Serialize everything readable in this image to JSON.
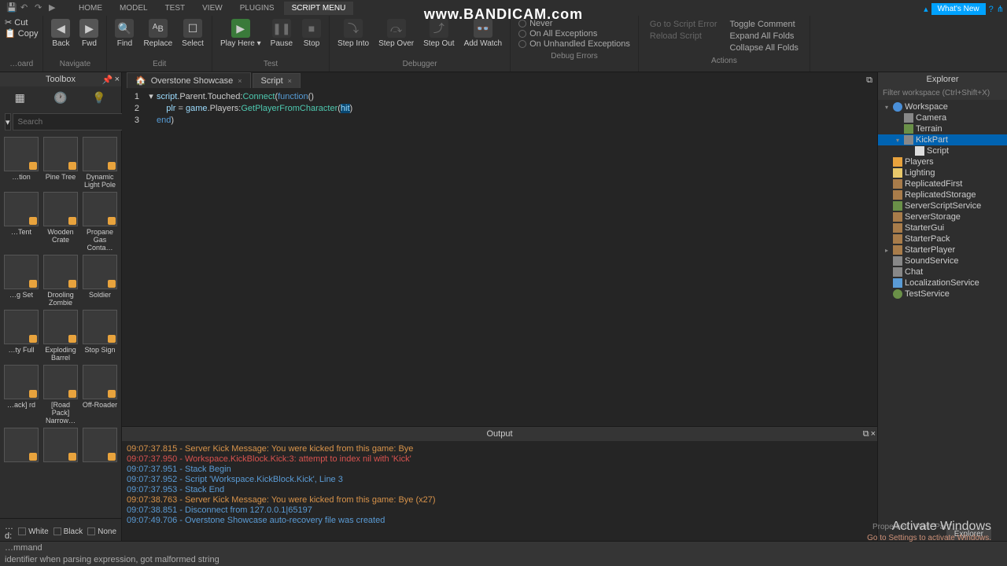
{
  "watermark": "www.BANDICAM.com",
  "menubar": {
    "tabs": [
      "HOME",
      "MODEL",
      "TEST",
      "VIEW",
      "PLUGINS",
      "SCRIPT MENU"
    ],
    "active": 5
  },
  "topright": {
    "whatsnew": "What's New"
  },
  "ribbon": {
    "clipboard": {
      "cut": "Cut",
      "copy": "Copy",
      "label": "…oard"
    },
    "navigate": {
      "back": "Back",
      "fwd": "Fwd",
      "label": "Navigate"
    },
    "edit": {
      "find": "Find",
      "replace": "Replace",
      "select": "Select",
      "label": "Edit"
    },
    "test": {
      "play": "Play\nHere ▾",
      "pause": "Pause",
      "stop": "Stop",
      "label": "Test"
    },
    "debugger": {
      "into": "Step\nInto",
      "over": "Step\nOver",
      "out": "Step\nOut",
      "add": "Add\nWatch",
      "label": "Debugger"
    },
    "errors": {
      "never": "Never",
      "all": "On All Exceptions",
      "unhandled": "On Unhandled Exceptions",
      "label": "Debug Errors"
    },
    "actions": {
      "goto": "Go to Script Error",
      "toggle": "Toggle Comment",
      "reload": "Reload Script",
      "expand": "Expand All Folds",
      "collapse": "Collapse All Folds",
      "label": "Actions"
    }
  },
  "toolbox": {
    "title": "Toolbox",
    "search_placeholder": "Search",
    "items": [
      {
        "label": "…tion"
      },
      {
        "label": "Pine Tree"
      },
      {
        "label": "Dynamic Light Pole"
      },
      {
        "label": "…Tent"
      },
      {
        "label": "Wooden Crate"
      },
      {
        "label": "Propane Gas Conta…"
      },
      {
        "label": "…g Set"
      },
      {
        "label": "Drooling Zombie"
      },
      {
        "label": "Soldier"
      },
      {
        "label": "…ty Full"
      },
      {
        "label": "Exploding Barrel"
      },
      {
        "label": "Stop Sign"
      },
      {
        "label": "…ack] rd"
      },
      {
        "label": "[Road Pack] Narrow…"
      },
      {
        "label": "Off-Roader"
      },
      {
        "label": ""
      },
      {
        "label": ""
      },
      {
        "label": ""
      }
    ],
    "footer": [
      "White",
      "Black",
      "None"
    ]
  },
  "tabs": [
    {
      "label": "Overstone Showcase",
      "active": false
    },
    {
      "label": "Script",
      "active": true
    }
  ],
  "code": {
    "lines": [
      "1",
      "2",
      "3"
    ]
  },
  "output": {
    "title": "Output",
    "lines": [
      {
        "cls": "out-orange",
        "text": "09:07:37.815 - Server Kick Message: You were kicked from this game: Bye"
      },
      {
        "cls": "out-red",
        "text": "09:07:37.950 - Workspace.KickBlock.Kick:3: attempt to index nil with 'Kick'"
      },
      {
        "cls": "out-blue",
        "text": "09:07:37.951 - Stack Begin"
      },
      {
        "cls": "out-blue",
        "text": "09:07:37.952 - Script 'Workspace.KickBlock.Kick', Line 3"
      },
      {
        "cls": "out-blue",
        "text": "09:07:37.953 - Stack End"
      },
      {
        "cls": "out-orange",
        "text": "09:07:38.763 - Server Kick Message: You were kicked from this game: Bye (x27)"
      },
      {
        "cls": "out-blue",
        "text": "09:07:38.851 - Disconnect from 127.0.0.1|65197"
      },
      {
        "cls": "out-blue",
        "text": "09:07:49.706 - Overstone Showcase auto-recovery file was created"
      }
    ]
  },
  "explorer": {
    "title": "Explorer",
    "filter": "Filter workspace (Ctrl+Shift+X)",
    "tree": [
      {
        "d": 0,
        "a": "▾",
        "i": "i-ws",
        "l": "Workspace"
      },
      {
        "d": 1,
        "a": "",
        "i": "i-cam",
        "l": "Camera"
      },
      {
        "d": 1,
        "a": "",
        "i": "i-ter",
        "l": "Terrain"
      },
      {
        "d": 1,
        "a": "▾",
        "i": "i-part",
        "l": "KickPart",
        "sel": true
      },
      {
        "d": 2,
        "a": "",
        "i": "i-scr",
        "l": "Script"
      },
      {
        "d": 0,
        "a": "",
        "i": "i-plr",
        "l": "Players"
      },
      {
        "d": 0,
        "a": "",
        "i": "i-lig",
        "l": "Lighting"
      },
      {
        "d": 0,
        "a": "",
        "i": "i-fold",
        "l": "ReplicatedFirst"
      },
      {
        "d": 0,
        "a": "",
        "i": "i-fold",
        "l": "ReplicatedStorage"
      },
      {
        "d": 0,
        "a": "",
        "i": "i-ss",
        "l": "ServerScriptService"
      },
      {
        "d": 0,
        "a": "",
        "i": "i-fold",
        "l": "ServerStorage"
      },
      {
        "d": 0,
        "a": "",
        "i": "i-fold",
        "l": "StarterGui"
      },
      {
        "d": 0,
        "a": "",
        "i": "i-fold",
        "l": "StarterPack"
      },
      {
        "d": 0,
        "a": "▸",
        "i": "i-fold",
        "l": "StarterPlayer"
      },
      {
        "d": 0,
        "a": "",
        "i": "i-gen",
        "l": "SoundService"
      },
      {
        "d": 0,
        "a": "",
        "i": "i-gen",
        "l": "Chat"
      },
      {
        "d": 0,
        "a": "",
        "i": "i-loc",
        "l": "LocalizationService"
      },
      {
        "d": 0,
        "a": "",
        "i": "i-test",
        "l": "TestService"
      }
    ]
  },
  "statusbar": {
    "row1": "…mmand",
    "row2": "identifier when parsing expression, got malformed string",
    "explorer_tab": "Explorer",
    "props": "Properties - Part \"Part\""
  },
  "activate": {
    "t": "Activate Windows",
    "s": "Go to Settings to activate Windows."
  }
}
